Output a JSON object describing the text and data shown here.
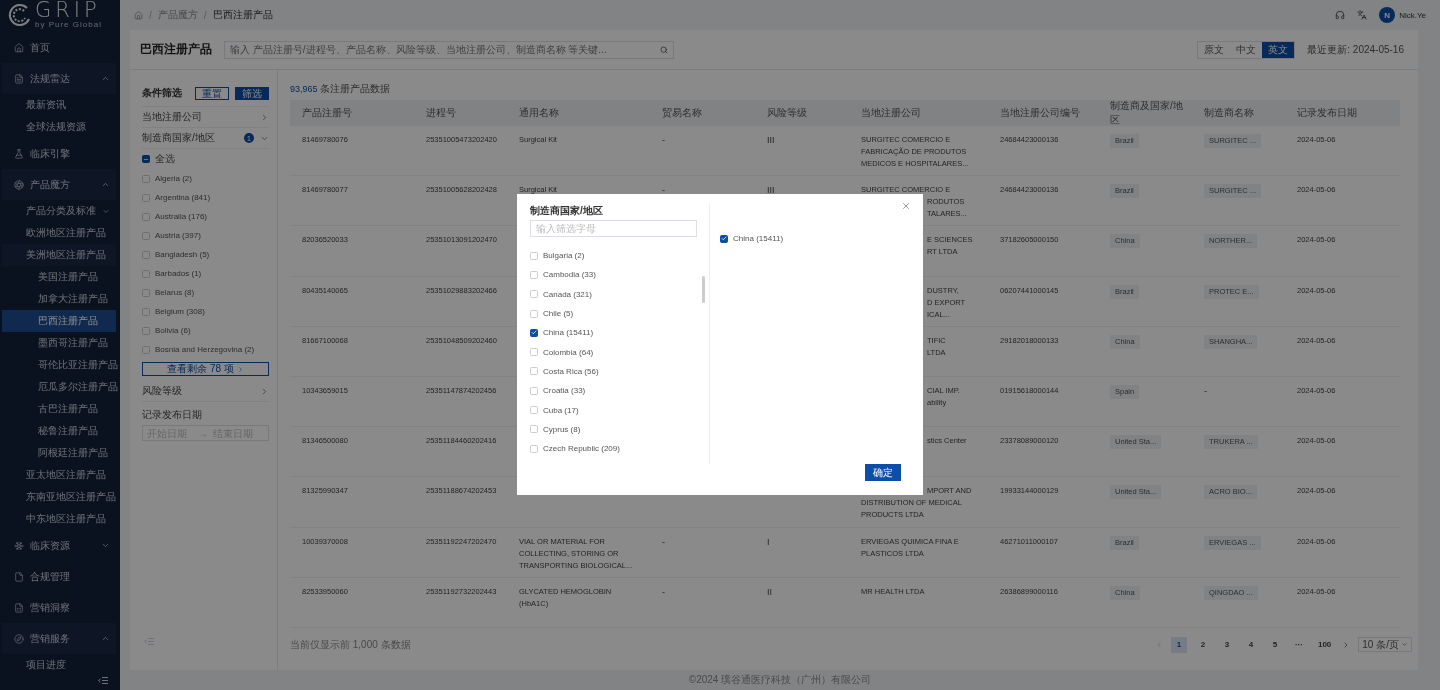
{
  "sidebar": {
    "logo": {
      "title": "GRIP",
      "tagline": "by Pure Global"
    },
    "items": [
      {
        "label": "首页",
        "selected": false
      },
      {
        "label": "法规雷达",
        "selected": false,
        "expanded": true,
        "children": [
          {
            "label": "最新资讯",
            "selected": false
          },
          {
            "label": "全球法规资源",
            "selected": false
          }
        ]
      },
      {
        "label": "临床引擎",
        "selected": false
      },
      {
        "label": "产品魔方",
        "selected": false,
        "expanded": true,
        "children": [
          {
            "label": "产品分类及标准",
            "selected": false,
            "expanded": false
          },
          {
            "label": "欧洲地区注册产品",
            "selected": false,
            "expanded": false
          },
          {
            "label": "美洲地区注册产品",
            "selected": false,
            "expanded": true,
            "children": [
              {
                "label": "美国注册产品",
                "selected": false
              },
              {
                "label": "加拿大注册产品",
                "selected": false
              },
              {
                "label": "巴西注册产品",
                "selected": true
              },
              {
                "label": "墨西哥注册产品",
                "selected": false
              },
              {
                "label": "哥伦比亚注册产品",
                "selected": false
              },
              {
                "label": "厄瓜多尔注册产品",
                "selected": false
              },
              {
                "label": "古巴注册产品",
                "selected": false
              },
              {
                "label": "秘鲁注册产品",
                "selected": false
              },
              {
                "label": "阿根廷注册产品",
                "selected": false
              }
            ]
          },
          {
            "label": "亚太地区注册产品",
            "selected": false,
            "expanded": false
          },
          {
            "label": "东南亚地区注册产品",
            "selected": false,
            "expanded": false
          },
          {
            "label": "中东地区注册产品",
            "selected": false,
            "expanded": false
          }
        ]
      },
      {
        "label": "临床资源",
        "selected": false,
        "expanded": false
      },
      {
        "label": "合规管理",
        "selected": false
      },
      {
        "label": "营销洞察",
        "selected": false
      },
      {
        "label": "营销服务",
        "selected": false,
        "expanded": true,
        "children": [
          {
            "label": "项目进度",
            "selected": false
          }
        ]
      }
    ]
  },
  "breadcrumb": [
    "产品魔方",
    "巴西注册产品"
  ],
  "breadcrumb_separator": "/",
  "user": {
    "initial": "N",
    "name": "Nick.Ye"
  },
  "page_title": "巴西注册产品",
  "search": {
    "placeholder": "输入 产品注册号/进程号、产品名称、风险等级、当地注册公司、制造商名称 等关键..."
  },
  "language_tabs": [
    {
      "label": "原文",
      "selected": false
    },
    {
      "label": "中文",
      "selected": false
    },
    {
      "label": "英文",
      "selected": true
    }
  ],
  "last_updated": "最近更新: 2024-05-16",
  "filters": {
    "title": "条件筛选",
    "reset": "重置",
    "apply": "筛选",
    "sections": [
      {
        "kind": "collapsible",
        "label": "当地注册公司",
        "expanded": false
      },
      {
        "kind": "checklist",
        "label": "制造商国家/地区",
        "badge": "1",
        "expanded": true,
        "select_all": {
          "label": "全选",
          "indeterminate": true
        },
        "options": [
          {
            "label": "Algeria (2)",
            "checked": false
          },
          {
            "label": "Argentina (841)",
            "checked": false
          },
          {
            "label": "Australia (176)",
            "checked": false
          },
          {
            "label": "Austria (397)",
            "checked": false
          },
          {
            "label": "Bangladesh (5)",
            "checked": false
          },
          {
            "label": "Barbados (1)",
            "checked": false
          },
          {
            "label": "Belarus (8)",
            "checked": false
          },
          {
            "label": "Belgium (308)",
            "checked": false
          },
          {
            "label": "Bolivia (6)",
            "checked": false
          },
          {
            "label": "Bosnia and Herzegovina (2)",
            "checked": false
          }
        ],
        "more": "查看剩余 78 项"
      },
      {
        "kind": "collapsible",
        "label": "风险等级",
        "expanded": false
      },
      {
        "kind": "date_range",
        "label": "记录发布日期",
        "start_placeholder": "开始日期",
        "separator": "→",
        "end_placeholder": "结束日期"
      }
    ]
  },
  "table": {
    "count": "93,965",
    "count_label": "条注册产品数据",
    "columns": [
      "产品注册号",
      "进程号",
      "通用名称",
      "贸易名称",
      "风险等级",
      "当地注册公司",
      "当地注册公司编号",
      "制造商及国家/地区",
      "制造商名称",
      "记录发布日期"
    ],
    "rows": [
      {
        "cells": [
          {
            "text": "81469780076",
            "kind": "text"
          },
          {
            "text": "25351005473202420",
            "kind": "text"
          },
          {
            "text": "Surgical Kit",
            "kind": "text"
          },
          {
            "text": "-",
            "kind": "muted"
          },
          {
            "text": "III",
            "kind": "muted"
          },
          {
            "text": "SURGITEC COMERCIO E FABRICAÇÃO DE PRODUTOS MEDICOS E HOSPITALARES...",
            "kind": "text"
          },
          {
            "text": "24684423000136",
            "kind": "text"
          },
          {
            "text": "Brazil",
            "kind": "tag"
          },
          {
            "text": "SURGITEC ...",
            "kind": "tag"
          },
          {
            "text": "2024-05-06",
            "kind": "text"
          }
        ]
      },
      {
        "cells": [
          {
            "text": "81469780077",
            "kind": "text"
          },
          {
            "text": "25351005628202428",
            "kind": "text"
          },
          {
            "text": "Surgical Kit",
            "kind": "text"
          },
          {
            "text": "-",
            "kind": "muted"
          },
          {
            "text": "III",
            "kind": "muted"
          },
          {
            "kind": "lines",
            "lines": [
              {
                "text": "SURGITEC COMERCIO E"
              },
              {
                "text": "RODUTOS",
                "clipped": true
              },
              {
                "text": "TALARES...",
                "clipped": true
              }
            ]
          },
          {
            "text": "24684423000136",
            "kind": "text"
          },
          {
            "text": "Brazil",
            "kind": "tag"
          },
          {
            "text": "SURGITEC ...",
            "kind": "tag"
          },
          {
            "text": "2024-05-06",
            "kind": "text"
          }
        ]
      },
      {
        "cells": [
          {
            "text": "82036520033",
            "kind": "text"
          },
          {
            "text": "25351013091202470",
            "kind": "text"
          },
          null,
          null,
          null,
          {
            "kind": "lines",
            "lines": [
              {
                "text": "E SCIENCES",
                "clipped": true
              },
              {
                "text": "RT LTDA",
                "clipped": true
              }
            ]
          },
          {
            "text": "37182605000150",
            "kind": "text"
          },
          {
            "text": "China",
            "kind": "tag"
          },
          {
            "text": "NORTHER...",
            "kind": "tag"
          },
          {
            "text": "2024-05-06",
            "kind": "text"
          }
        ]
      },
      {
        "cells": [
          {
            "text": "80435140065",
            "kind": "text"
          },
          {
            "text": "25351029883202466",
            "kind": "text"
          },
          null,
          null,
          null,
          {
            "kind": "lines",
            "lines": [
              {
                "text": "DUSTRY,",
                "clipped": true
              },
              {
                "text": "D EXPORT",
                "clipped": true
              },
              {
                "text": "ICAL...",
                "clipped": true
              }
            ]
          },
          {
            "text": "06207441000145",
            "kind": "text"
          },
          {
            "text": "Brazil",
            "kind": "tag"
          },
          {
            "text": "PROTEC E...",
            "kind": "tag"
          },
          {
            "text": "2024-05-06",
            "kind": "text"
          }
        ]
      },
      {
        "cells": [
          {
            "text": "81667100068",
            "kind": "text"
          },
          {
            "text": "25351048509202460",
            "kind": "text"
          },
          null,
          null,
          null,
          {
            "kind": "lines",
            "lines": [
              {
                "text": "TIFIC",
                "clipped": true
              },
              {
                "text": "LTDA",
                "clipped": true
              }
            ]
          },
          {
            "text": "29182018000133",
            "kind": "text"
          },
          {
            "text": "China",
            "kind": "tag"
          },
          {
            "text": "SHANGHA...",
            "kind": "tag"
          },
          {
            "text": "2024-05-06",
            "kind": "text"
          }
        ]
      },
      {
        "cells": [
          {
            "text": "10343659015",
            "kind": "text"
          },
          {
            "text": "25351147874202456",
            "kind": "text"
          },
          null,
          null,
          null,
          {
            "kind": "lines",
            "lines": [
              {
                "text": "CIAL IMP.",
                "clipped": true
              },
              {
                "text": "ability",
                "clipped": true
              }
            ]
          },
          {
            "text": "01915618000144",
            "kind": "text"
          },
          {
            "text": "Spain",
            "kind": "tag"
          },
          {
            "text": "-",
            "kind": "muted"
          },
          {
            "text": "2024-05-06",
            "kind": "text"
          }
        ]
      },
      {
        "cells": [
          {
            "text": "81346500080",
            "kind": "text"
          },
          {
            "text": "25351184460202416",
            "kind": "text"
          },
          null,
          null,
          null,
          {
            "kind": "lines",
            "lines": [
              {
                "text": "stics Center",
                "clipped": true
              }
            ]
          },
          {
            "text": "23378089000120",
            "kind": "text"
          },
          {
            "text": "United Sta...",
            "kind": "tag"
          },
          {
            "text": "TRUKERA ...",
            "kind": "tag"
          },
          {
            "text": "2024-05-06",
            "kind": "text"
          }
        ]
      },
      {
        "cells": [
          {
            "text": "81325990347",
            "kind": "text"
          },
          {
            "text": "25351188674202453",
            "kind": "text"
          },
          null,
          null,
          null,
          {
            "kind": "lines",
            "lines": [
              {
                "text": "MPORT AND",
                "clipped": true
              },
              {
                "text": "DISTRIBUTION OF MEDICAL"
              },
              {
                "text": "PRODUCTS LTDA"
              }
            ]
          },
          {
            "text": "19933144000129",
            "kind": "text"
          },
          {
            "text": "United Sta...",
            "kind": "tag"
          },
          {
            "text": "ACRO BIO...",
            "kind": "tag"
          },
          {
            "text": "2024-05-06",
            "kind": "text"
          }
        ]
      },
      {
        "cells": [
          {
            "text": "10039370008",
            "kind": "text"
          },
          {
            "text": "25351192247202470",
            "kind": "text"
          },
          {
            "text": "VIAL OR MATERIAL FOR COLLECTING, STORING OR TRANSPORTING BIOLOGICAL...",
            "kind": "text"
          },
          {
            "text": "-",
            "kind": "muted"
          },
          {
            "text": "I",
            "kind": "muted"
          },
          {
            "text": "ERVIEGAS QUIMICA FINA E PLASTICOS LTDA",
            "kind": "text"
          },
          {
            "text": "46271011000107",
            "kind": "text"
          },
          {
            "text": "Brazil",
            "kind": "tag"
          },
          {
            "text": "ERVIEGAS ...",
            "kind": "tag"
          },
          {
            "text": "2024-05-06",
            "kind": "text"
          }
        ]
      },
      {
        "cells": [
          {
            "text": "82533950060",
            "kind": "text"
          },
          {
            "text": "25351192732202443",
            "kind": "text"
          },
          {
            "text": "GLYCATED HEMOGLOBIN (HbA1C)",
            "kind": "text"
          },
          {
            "text": "-",
            "kind": "muted"
          },
          {
            "text": "II",
            "kind": "muted"
          },
          {
            "text": "MR HEALTH LTDA",
            "kind": "text"
          },
          {
            "text": "26386899000116",
            "kind": "text"
          },
          {
            "text": "China",
            "kind": "tag"
          },
          {
            "text": "QINGDAO ...",
            "kind": "tag"
          },
          {
            "text": "2024-05-06",
            "kind": "text"
          }
        ]
      }
    ]
  },
  "pagination": {
    "note": "当前仅显示前 1,000 条数据",
    "pages": [
      {
        "label": "1",
        "selected": true
      },
      {
        "label": "2",
        "selected": false
      },
      {
        "label": "3",
        "selected": false
      },
      {
        "label": "4",
        "selected": false
      },
      {
        "label": "5",
        "selected": false
      },
      {
        "label": "···",
        "selected": false
      },
      {
        "label": "100",
        "selected": false
      }
    ],
    "page_size": "10 条/页"
  },
  "copyright": "©2024 璞谷通医疗科技（广州）有限公司",
  "modal": {
    "title": "制造商国家/地区",
    "search_placeholder": "输入筛选字母",
    "options": [
      {
        "label": "Bulgaria (2)",
        "checked": false
      },
      {
        "label": "Cambodia (33)",
        "checked": false
      },
      {
        "label": "Canada (321)",
        "checked": false
      },
      {
        "label": "Chile (5)",
        "checked": false
      },
      {
        "label": "China (15411)",
        "checked": true
      },
      {
        "label": "Colombia (64)",
        "checked": false
      },
      {
        "label": "Costa Rica (56)",
        "checked": false
      },
      {
        "label": "Croatia (33)",
        "checked": false
      },
      {
        "label": "Cuba (17)",
        "checked": false
      },
      {
        "label": "Cyprus (8)",
        "checked": false
      },
      {
        "label": "Czech Republic (209)",
        "checked": false
      }
    ],
    "selected": [
      {
        "label": "China (15411)",
        "checked": true
      }
    ],
    "confirm": "确定"
  }
}
